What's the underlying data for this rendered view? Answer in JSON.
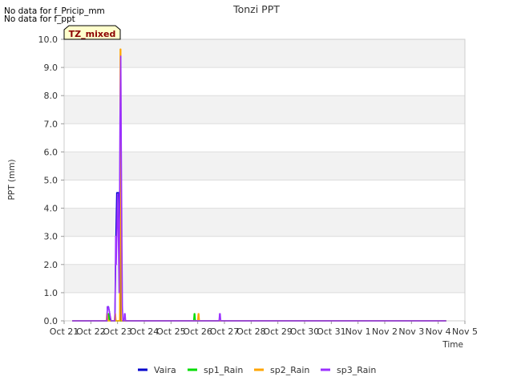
{
  "messages": [
    "No data for f_Pricip_mm",
    "No data for f_ppt"
  ],
  "badge": "TZ_mixed",
  "chart_data": {
    "type": "line",
    "title": "Tonzi PPT",
    "xlabel": "Time",
    "ylabel": "PPT (mm)",
    "xlim": [
      0,
      15
    ],
    "ylim": [
      0,
      10
    ],
    "x_ticks": [
      "Oct 21",
      "Oct 22",
      "Oct 23",
      "Oct 24",
      "Oct 25",
      "Oct 26",
      "Oct 27",
      "Oct 28",
      "Oct 29",
      "Oct 30",
      "Oct 31",
      "Nov 1",
      "Nov 2",
      "Nov 3",
      "Nov 4",
      "Nov 5"
    ],
    "y_ticks": [
      "0.0",
      "1.0",
      "2.0",
      "3.0",
      "4.0",
      "5.0",
      "6.0",
      "7.0",
      "8.0",
      "9.0",
      "10.0"
    ],
    "grid": true,
    "legend_position": "bottom",
    "series": [
      {
        "name": "Vaira",
        "color": "#0000cc",
        "x": [
          0.3,
          1.6,
          1.62,
          1.66,
          1.7,
          1.74,
          1.8,
          1.9,
          1.94,
          1.97,
          2.0,
          2.05,
          2.08,
          2.12,
          2.15,
          2.2,
          2.3,
          14.3
        ],
        "y": [
          0,
          0,
          0.5,
          0.5,
          0.3,
          0,
          0,
          0,
          3.0,
          4.55,
          4.55,
          4.55,
          3.0,
          0,
          0,
          0,
          0,
          0
        ]
      },
      {
        "name": "sp1_Rain",
        "color": "#00dd00",
        "x": [
          0.3,
          1.64,
          1.66,
          1.68,
          1.7,
          4.85,
          4.87,
          4.89,
          4.91,
          14.3
        ],
        "y": [
          0,
          0,
          0.25,
          0.25,
          0,
          0,
          0.25,
          0.25,
          0,
          0
        ]
      },
      {
        "name": "sp2_Rain",
        "color": "#ffa500",
        "x": [
          0.3,
          1.58,
          1.6,
          1.62,
          1.64,
          1.88,
          1.9,
          1.92,
          1.94,
          2.08,
          2.1,
          2.12,
          2.14,
          5.0,
          5.02,
          5.04,
          5.06,
          14.3
        ],
        "y": [
          0,
          0,
          0.25,
          0.25,
          0,
          0,
          0.25,
          0.25,
          0,
          0,
          9.65,
          9.65,
          0,
          0,
          0.25,
          0.25,
          0,
          0
        ]
      },
      {
        "name": "sp3_Rain",
        "color": "#9b30ff",
        "x": [
          0.3,
          1.6,
          1.62,
          1.65,
          1.68,
          1.72,
          1.76,
          1.9,
          1.93,
          1.95,
          1.97,
          2.0,
          2.03,
          2.06,
          2.09,
          2.12,
          2.14,
          2.16,
          2.18,
          2.2,
          2.24,
          2.26,
          2.28,
          2.3,
          5.8,
          5.82,
          5.84,
          5.86,
          14.3
        ],
        "y": [
          0,
          0,
          0.5,
          0.5,
          0.4,
          0.2,
          0,
          0,
          3.0,
          2.0,
          3.0,
          4.5,
          3.0,
          1.0,
          7.0,
          9.4,
          6.0,
          3.0,
          0.5,
          0,
          0,
          0.25,
          0.25,
          0,
          0,
          0.25,
          0.25,
          0,
          0
        ]
      }
    ]
  }
}
